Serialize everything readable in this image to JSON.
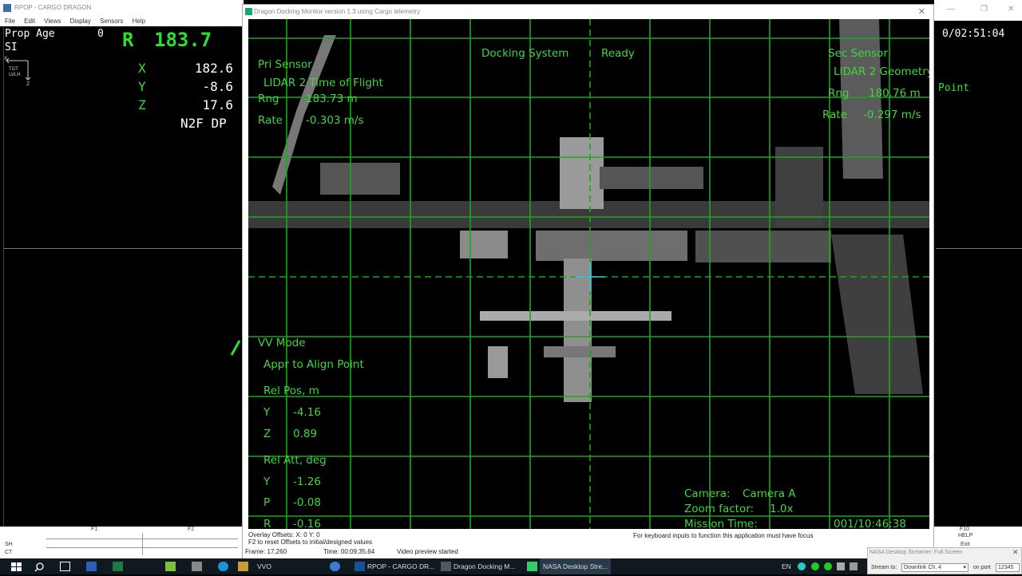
{
  "rpop": {
    "title": "RPOP - CARGO DRAGON",
    "menu": [
      "File",
      "Edit",
      "Views",
      "Display",
      "Sensors",
      "Help"
    ],
    "prop_age_label": "Prop Age",
    "prop_age_value": "0",
    "si_label": "SI",
    "range_label": "R",
    "range_value": "183.7",
    "x_label": "X",
    "x_value": "182.6",
    "y_label": "Y",
    "y_value": "-8.6",
    "z_label": "Z",
    "z_value": "17.6",
    "mode": "N2F DP",
    "frame_tgt": "TGT",
    "frame_lvlh": "LVLH",
    "frame_x": "X",
    "frame_z": "Z",
    "clock": "0/02:51:04",
    "right_label": "Point",
    "bottom_f1": "F1",
    "bottom_f2": "F2",
    "bottom_sh": "SH",
    "bottom_ct": "CT",
    "help_f10": "F10",
    "help_label": "HELP",
    "exit_label": "Exit"
  },
  "dragon": {
    "title": "Dragon Docking Monitor version 1.3 using Cargo telemetry",
    "close": "✕",
    "pri_sensor": {
      "title": "Pri Sensor",
      "name": "LIDAR 2 Time of Flight",
      "rng_label": "Rng",
      "rng_value": "183.73 m",
      "rate_label": "Rate",
      "rate_value": "-0.303 m/s"
    },
    "docking_system_label": "Docking System",
    "docking_status": "Ready",
    "sec_sensor": {
      "title": "Sec Sensor",
      "name": "LIDAR 2 Geometry",
      "rng_label": "Rng",
      "rng_value": "180.76 m",
      "rate_label": "Rate",
      "rate_value": "-0.297 m/s"
    },
    "vv_mode_label": "VV Mode",
    "vv_mode_value": "Appr to Align Point",
    "rel_pos_label": "Rel Pos, m",
    "rel_pos": [
      {
        "axis": "Y",
        "value": "-4.16"
      },
      {
        "axis": "Z",
        "value": "0.89"
      }
    ],
    "rel_att_label": "Rel Att, deg",
    "rel_att": [
      {
        "axis": "Y",
        "value": "-1.26"
      },
      {
        "axis": "P",
        "value": "-0.08"
      },
      {
        "axis": "R",
        "value": "-0.16"
      }
    ],
    "camera_label": "Camera:",
    "camera_value": "Camera A",
    "zoom_label": "Zoom factor:",
    "zoom_value": "1.0x",
    "mission_time_label": "Mission Time:",
    "mission_time_value": "001/10:46:38",
    "status": {
      "overlay_offsets": "Overlay Offsets:  X: 0    Y: 0",
      "reset_hint": "F2 to reset Offsets to initial/designed values",
      "keyboard_hint": "For keyboard inputs to function this application must have focus",
      "frame": "Frame:  17,260",
      "time": "Time:  00:09:35.64",
      "video": "Video preview started"
    }
  },
  "taskbar": {
    "items": [
      "VVO",
      "RPOP - CARGO DR...",
      "Dragon Docking M...",
      "NASA Desktop Stre..."
    ],
    "lang": "EN",
    "colors": {
      "bg": "#101820",
      "green": "#3ed83e"
    }
  },
  "streamer": {
    "title": "NASA Desktop Streamer: Full Screen",
    "stream_to_label": "Stream to:",
    "stream_to_value": "Downlink Ch. 4",
    "port_label": "on port",
    "port_value": "12345"
  }
}
